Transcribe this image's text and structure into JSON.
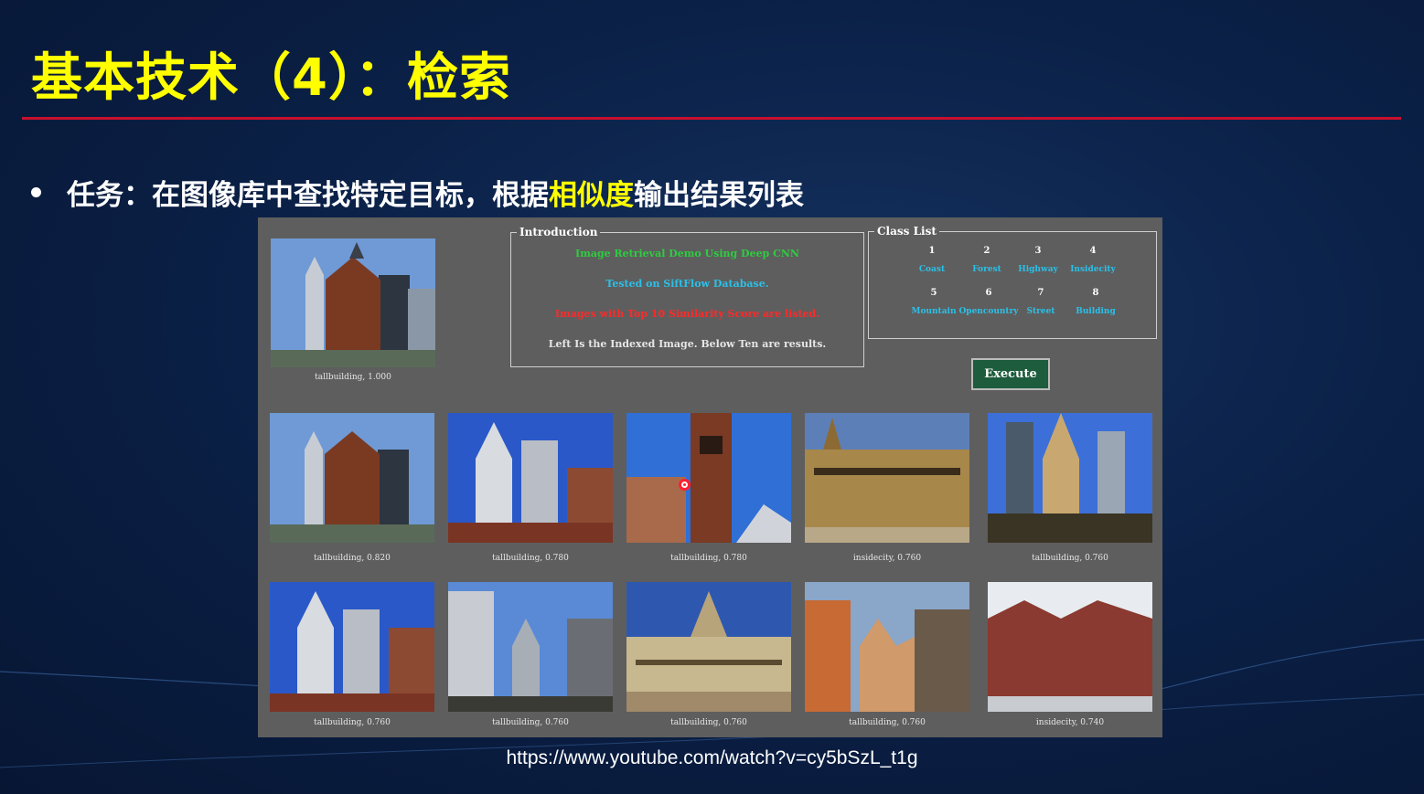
{
  "slide": {
    "title": "基本技术（4）：检索",
    "bullet_prefix": "任务：在图像库中查找特定目标，根据",
    "bullet_highlight": "相似度",
    "bullet_suffix": "输出结果列表",
    "video_url": "https://www.youtube.com/watch?v=cy5bSzL_t1g",
    "colors": {
      "title": "#ffff00",
      "rule": "#c8102e",
      "highlight": "#ffff00"
    }
  },
  "demo": {
    "query": {
      "caption": "tallbuilding, 1.000",
      "icon": "building-photo-icon"
    },
    "introduction": {
      "legend": "Introduction",
      "lines": [
        {
          "text": "Image Retrieval Demo Using Deep CNN",
          "color": "#2ecc40"
        },
        {
          "text": "Tested on SiftFlow Database.",
          "color": "#2bc0e8"
        },
        {
          "text": "Images with Top 10 Similarity Score are listed.",
          "color": "#ff2a2a"
        },
        {
          "text": "Left Is the Indexed Image. Below Ten are results.",
          "color": "#e6e6e6"
        }
      ]
    },
    "class_list": {
      "legend": "Class List",
      "classes": [
        {
          "num": "1",
          "name": "Coast"
        },
        {
          "num": "2",
          "name": "Forest"
        },
        {
          "num": "3",
          "name": "Highway"
        },
        {
          "num": "4",
          "name": "Insidecity"
        },
        {
          "num": "5",
          "name": "Mountain"
        },
        {
          "num": "6",
          "name": "Opencountry"
        },
        {
          "num": "7",
          "name": "Street"
        },
        {
          "num": "8",
          "name": "Building"
        }
      ]
    },
    "execute_label": "Execute",
    "results": [
      {
        "caption": "tallbuilding, 0.820"
      },
      {
        "caption": "tallbuilding, 0.780"
      },
      {
        "caption": "tallbuilding, 0.780"
      },
      {
        "caption": "insidecity, 0.760"
      },
      {
        "caption": "tallbuilding, 0.760"
      },
      {
        "caption": "tallbuilding, 0.760"
      },
      {
        "caption": "tallbuilding, 0.760"
      },
      {
        "caption": "tallbuilding, 0.760"
      },
      {
        "caption": "tallbuilding, 0.760"
      },
      {
        "caption": "insidecity, 0.740"
      }
    ]
  }
}
